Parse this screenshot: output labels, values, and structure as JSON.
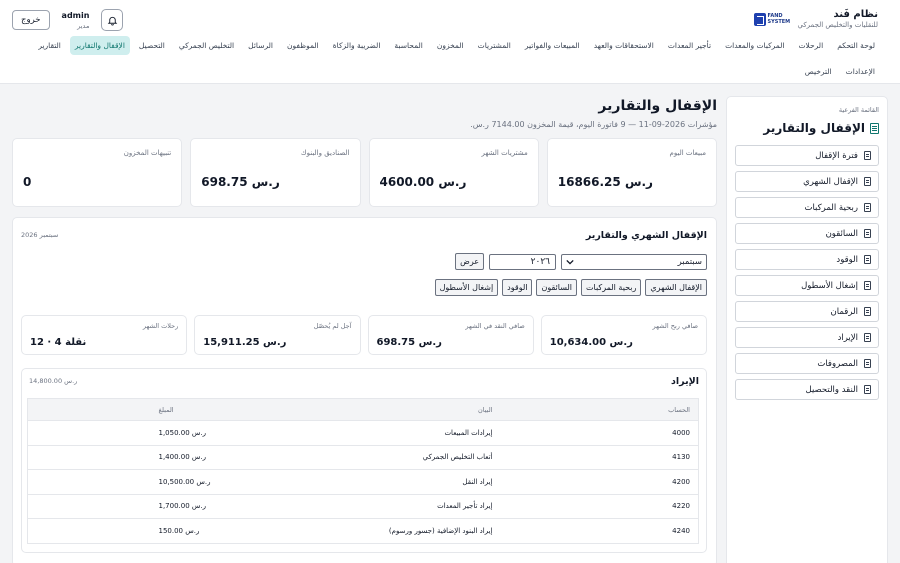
{
  "brand": {
    "name": "نظام فَند",
    "subtitle": "للنقليات والتخليص الجمركي",
    "logo_text_1": "FAND",
    "logo_text_2": "SYSTEM"
  },
  "user": {
    "logout_label": "خروج",
    "name": "admin",
    "role": "مدير"
  },
  "nav": [
    {
      "label": "لوحة التحكم"
    },
    {
      "label": "الرحلات"
    },
    {
      "label": "المركبات والمعدات"
    },
    {
      "label": "تأجير المعدات"
    },
    {
      "label": "الاستحقاقات والعهد"
    },
    {
      "label": "المبيعات والفواتير"
    },
    {
      "label": "المشتريات"
    },
    {
      "label": "المخزون"
    },
    {
      "label": "المحاسبة"
    },
    {
      "label": "الضريبة والزكاة"
    },
    {
      "label": "الموظفون"
    },
    {
      "label": "الرسائل"
    },
    {
      "label": "التخليص الجمركي"
    },
    {
      "label": "التحصيل"
    },
    {
      "label": "الإقفال والتقارير"
    },
    {
      "label": "التقارير"
    },
    {
      "label": "الإعدادات"
    },
    {
      "label": "الترخيص"
    }
  ],
  "nav_active_index": 14,
  "sidebar": {
    "caption": "القائمة الفرعية",
    "title": "الإقفال والتقارير",
    "items": [
      {
        "label": "فترة الإقفال"
      },
      {
        "label": "الإقفال الشهري"
      },
      {
        "label": "ربحية المركبات"
      },
      {
        "label": "السائقون"
      },
      {
        "label": "الوقود"
      },
      {
        "label": "إشغال الأسطول"
      },
      {
        "label": "الرقمان"
      },
      {
        "label": "الإيراد"
      },
      {
        "label": "المصروفات"
      },
      {
        "label": "النقد والتحصيل"
      }
    ]
  },
  "page": {
    "title": "الإقفال والتقارير",
    "subtitle": "مؤشرات 2026-09-11 — 9 فاتورة اليوم، قيمة المخزون 7144.00 ر.س."
  },
  "kpis": [
    {
      "label": "مبيعات اليوم",
      "value": "16866.25 ر.س"
    },
    {
      "label": "مشتريات الشهر",
      "value": "4600.00 ر.س"
    },
    {
      "label": "الصناديق والبنوك",
      "value": "698.75 ر.س"
    },
    {
      "label": "تنبيهات المخزون",
      "value": "0"
    }
  ],
  "panel": {
    "title": "الإقفال الشهري والتقارير",
    "period": "سبتمبر 2026",
    "month_value": "سبتمبر",
    "year_value": "٢٠٢٦",
    "show_label": "عرض",
    "report_buttons": [
      {
        "label": "الإقفال الشهري"
      },
      {
        "label": "ربحية المركبات"
      },
      {
        "label": "السائقون"
      },
      {
        "label": "الوقود"
      },
      {
        "label": "إشغال الأسطول"
      }
    ],
    "stats": [
      {
        "label": "صافي ربح الشهر",
        "value": "10,634.00 ر.س"
      },
      {
        "label": "صافي النقد في الشهر",
        "value": "698.75 ر.س"
      },
      {
        "label": "آجل لم يُحصّل",
        "value": "15,911.25 ر.س"
      },
      {
        "label": "رحلات الشهر",
        "value": "12 · 4 نقلة"
      }
    ]
  },
  "revenue": {
    "title": "الإيراد",
    "total": "14,800.00 ر.س",
    "headers": {
      "account": "الحساب",
      "name": "البيان",
      "amount": "المبلغ"
    },
    "rows": [
      {
        "account": "4000",
        "name": "إيرادات المبيعات",
        "amount": "1,050.00 ر.س"
      },
      {
        "account": "4130",
        "name": "أتعاب التخليص الجمركي",
        "amount": "1,400.00 ر.س"
      },
      {
        "account": "4200",
        "name": "إيراد النقل",
        "amount": "10,500.00 ر.س"
      },
      {
        "account": "4220",
        "name": "إيراد تأجير المعدات",
        "amount": "1,700.00 ر.س"
      },
      {
        "account": "4240",
        "name": "إيراد البنود الإضافية (جسور ورسوم)",
        "amount": "150.00 ر.س"
      }
    ]
  }
}
